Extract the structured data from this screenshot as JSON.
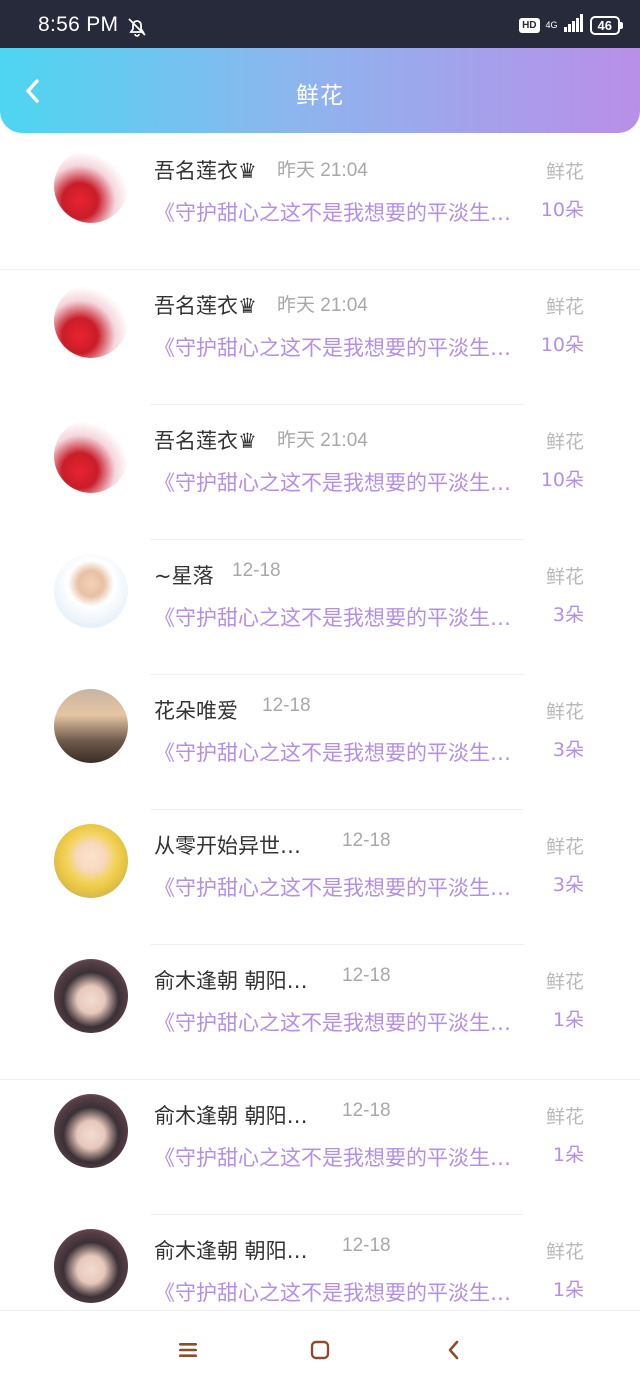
{
  "status_bar": {
    "time": "8:56 PM",
    "hd": "HD",
    "network": "4G",
    "battery": "46"
  },
  "header": {
    "title": "鲜花"
  },
  "items": [
    {
      "name": "吾名莲衣♛",
      "time": "昨天 21:04",
      "book": "《守护甜心之这不是我想要的平淡生活》",
      "type": "鲜花",
      "count": "10朵",
      "avatar": "red"
    },
    {
      "name": "吾名莲衣♛",
      "time": "昨天 21:04",
      "book": "《守护甜心之这不是我想要的平淡生活》",
      "type": "鲜花",
      "count": "10朵",
      "avatar": "red"
    },
    {
      "name": "吾名莲衣♛",
      "time": "昨天 21:04",
      "book": "《守护甜心之这不是我想要的平淡生活》",
      "type": "鲜花",
      "count": "10朵",
      "avatar": "red"
    },
    {
      "name": "~星落",
      "time": "12-18",
      "book": "《守护甜心之这不是我想要的平淡生活》",
      "type": "鲜花",
      "count": "3朵",
      "avatar": "boy"
    },
    {
      "name": "花朵唯爱",
      "time": "12-18",
      "book": "《守护甜心之这不是我想要的平淡生活》",
      "type": "鲜花",
      "count": "3朵",
      "avatar": "room"
    },
    {
      "name": "从零开始异世…",
      "time": "12-18",
      "book": "《守护甜心之这不是我想要的平淡生活》",
      "type": "鲜花",
      "count": "3朵",
      "avatar": "anime"
    },
    {
      "name": "俞木逢朝 朝阳…",
      "time": "12-18",
      "book": "《守护甜心之这不是我想要的平淡生活》",
      "type": "鲜花",
      "count": "1朵",
      "avatar": "dark"
    },
    {
      "name": "俞木逢朝 朝阳…",
      "time": "12-18",
      "book": "《守护甜心之这不是我想要的平淡生活》",
      "type": "鲜花",
      "count": "1朵",
      "avatar": "dark"
    },
    {
      "name": "俞木逢朝 朝阳…",
      "time": "12-18",
      "book": "《守护甜心之这不是我想要的平淡生活》",
      "type": "鲜花",
      "count": "1朵",
      "avatar": "dark"
    }
  ],
  "nav": {
    "menu_icon": "menu-icon",
    "home_icon": "home-icon",
    "back_icon": "back-icon"
  },
  "colors": {
    "header_start": "#4dd6f1",
    "header_end": "#b98fe8",
    "accent": "#b48fe6"
  }
}
